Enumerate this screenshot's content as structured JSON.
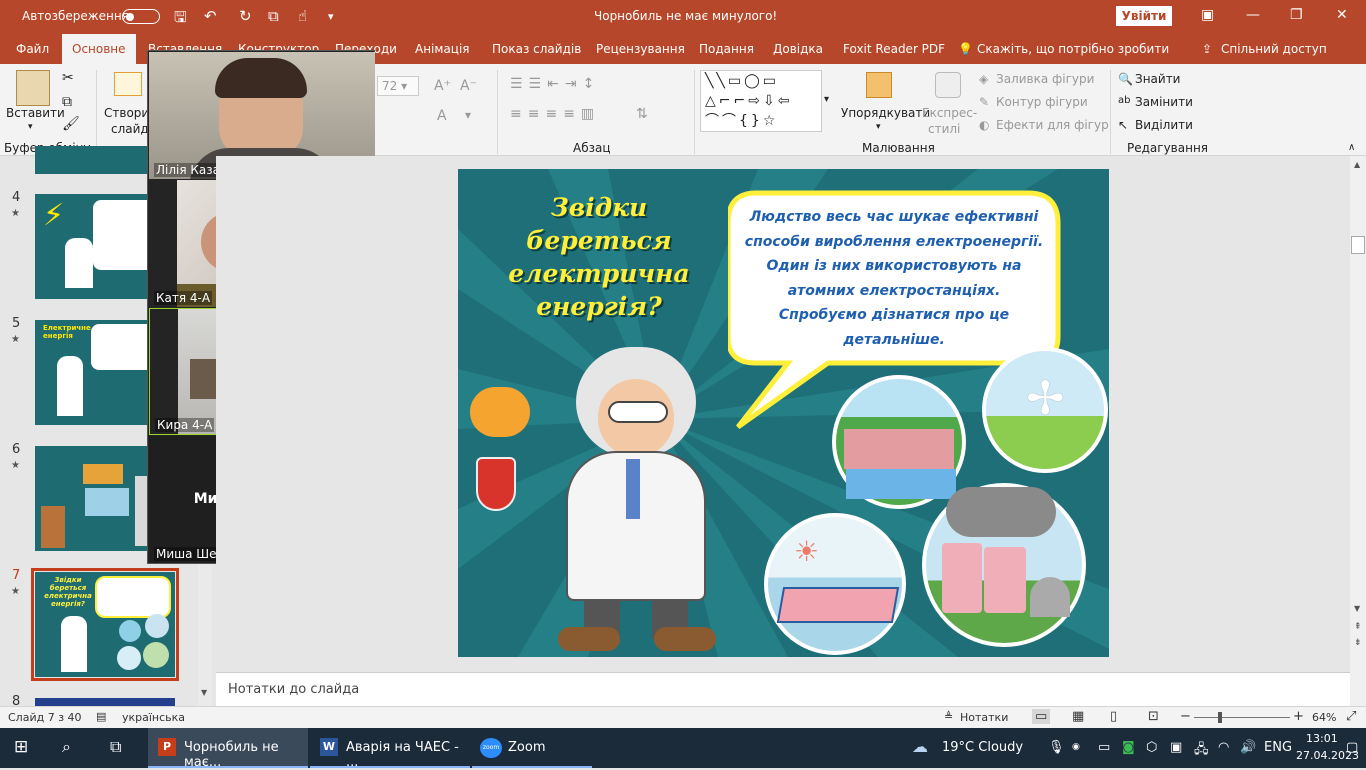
{
  "titlebar": {
    "autosave": "Автозбереження",
    "title": "Чорнобиль не має минулого!",
    "signin": "Увійти",
    "minimize": "—",
    "restore": "❐",
    "close": "✕"
  },
  "tabs": {
    "file": "Файл",
    "home": "Основне",
    "insert": "Вставлення",
    "design": "Конструктор",
    "transitions": "Переходи",
    "animation": "Анімація",
    "slideshow": "Показ слайдів",
    "review": "Рецензування",
    "view": "Подання",
    "help": "Довідка",
    "foxit": "Foxit Reader PDF",
    "tellme": "Скажіть, що потрібно зробити",
    "share": "Спільний доступ"
  },
  "ribbon": {
    "paste": "Вставити",
    "clipboard": "Буфер обміну",
    "newslide_line1": "Створи",
    "newslide_line2": "слайд",
    "fontsize": "72",
    "paragraph": "Абзац",
    "arrange": "Упорядкувати",
    "quickstyles_line1": "Експрес-",
    "quickstyles_line2": "стилі",
    "fill": "Заливка фігури",
    "outline": "Контур фігури",
    "effects": "Ефекти для фігур",
    "drawing": "Малювання",
    "find": "Знайти",
    "replace": "Замінити",
    "select": "Виділити",
    "editing": "Редагування"
  },
  "slides": [
    {
      "num": "4",
      "star": "★"
    },
    {
      "num": "5",
      "star": "★"
    },
    {
      "num": "6",
      "star": "★"
    },
    {
      "num": "7",
      "star": "★"
    },
    {
      "num": "8",
      "star": ""
    }
  ],
  "thumb_texts": {
    "t5_title": "Електричне енергія",
    "t7_title": "Звідки береться електрична енергія?"
  },
  "zoom": {
    "p1": "Лілія Казаріна",
    "p2": "Катя  4-А",
    "p3": "Кира 4-А",
    "p4_center": "Миша Шевченко",
    "p4": "Миша Шевченко"
  },
  "slide": {
    "title": "Звідки береться електрична енергія?",
    "bubble": "Людство весь час шукає ефективні способи вироблення електроенергії. Один із них використовують на атомних електростанціях. Спробуємо дізнатися про це детальніше."
  },
  "notes": "Нотатки до слайда",
  "status": {
    "slide": "Слайд 7 з 40",
    "lang": "українська",
    "notes": "Нотатки",
    "zoom": "64%"
  },
  "taskbar": {
    "ppt": "Чорнобиль не має...",
    "word": "Аварія на ЧАЕС - ...",
    "zoom": "Zoom",
    "weather": "19°C  Cloudy",
    "lang": "ENG",
    "time": "13:01",
    "date": "27.04.2023"
  },
  "colors": {
    "accent": "#b7472a",
    "slide_bg": "#1e6f78",
    "title_yellow": "#ffef3a",
    "bubble_text": "#1f5fb0"
  }
}
